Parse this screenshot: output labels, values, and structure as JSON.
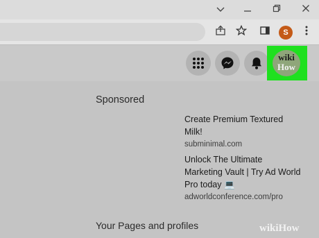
{
  "window": {
    "minimize_icon": "chevron-down-icon",
    "restore_icon": "minimize-icon",
    "maximize_icon": "restore-icon",
    "close_icon": "close-icon"
  },
  "toolbar": {
    "profile_initial": "S",
    "profile_color": "#c45a17"
  },
  "facebook_header": {
    "avatar_text_line1": "wiki",
    "avatar_text_line2": "How",
    "highlight_color": "#1fe01f"
  },
  "sidebar": {
    "sponsored_heading": "Sponsored",
    "ads": [
      {
        "title": "Create Premium Textured Milk!",
        "domain": "subminimal.com"
      },
      {
        "title": "Unlock The Ultimate Marketing Vault | Try Ad World Pro today 💻",
        "domain": "adworldconference.com/pro"
      }
    ],
    "pages_heading": "Your Pages and profiles"
  },
  "watermark": "wikiHow"
}
